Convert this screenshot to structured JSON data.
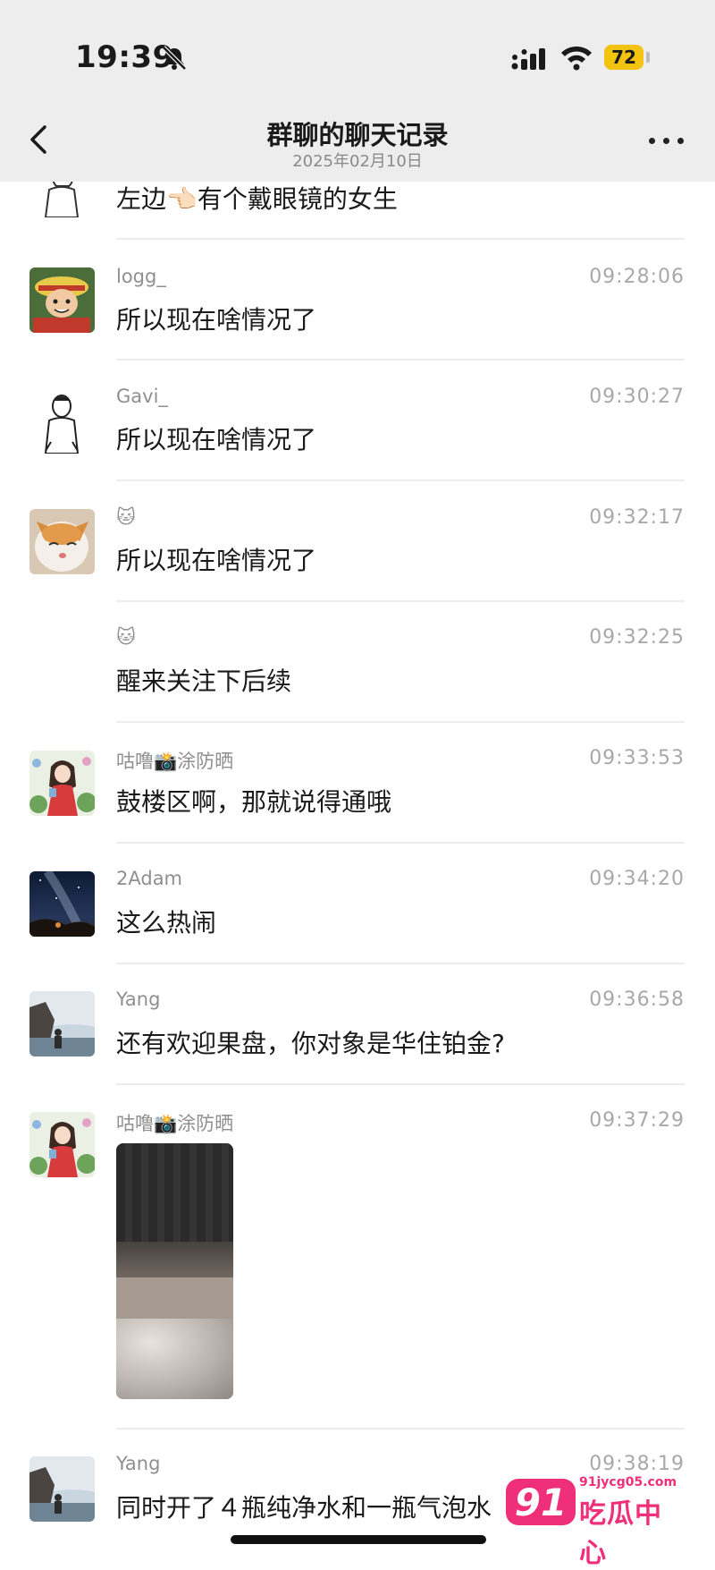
{
  "status_bar": {
    "time": "19:39",
    "battery": "72"
  },
  "header": {
    "title": "群聊的聊天记录",
    "date": "2025年02月10日"
  },
  "messages": [
    {
      "sender": "",
      "time": "",
      "text": "左边👈🏻有个戴眼镜的女生",
      "avatar": "sketch-man"
    },
    {
      "sender": "logg_",
      "time": "09:28:06",
      "text": "所以现在啥情况了",
      "avatar": "anime-pirate"
    },
    {
      "sender": "Gavi_",
      "time": "09:30:27",
      "text": "所以现在啥情况了",
      "avatar": "sketch-man"
    },
    {
      "sender": "🐱",
      "time": "09:32:17",
      "text": "所以现在啥情况了",
      "avatar": "cat"
    },
    {
      "sender": "🐱",
      "time": "09:32:25",
      "text": "醒来关注下后续",
      "avatar": ""
    },
    {
      "sender": "咕噜📸涂防晒",
      "time": "09:33:53",
      "text": "鼓楼区啊，那就说得通哦",
      "avatar": "illustrated-girl"
    },
    {
      "sender": "2Adam",
      "time": "09:34:20",
      "text": "这么热闹",
      "avatar": "night-sky"
    },
    {
      "sender": "Yang",
      "time": "09:36:58",
      "text": "还有欢迎果盘，你对象是华住铂金?",
      "avatar": "seaside-rock"
    },
    {
      "sender": "咕噜📸涂防晒",
      "time": "09:37:29",
      "text": "",
      "avatar": "illustrated-girl",
      "image": "hotel-room-photo"
    },
    {
      "sender": "Yang",
      "time": "09:38:19",
      "text": "同时开了４瓶纯净水和一瓶气泡水",
      "avatar": "seaside-rock"
    }
  ],
  "watermark": {
    "badge": "91",
    "url": "91jycg05.com",
    "name": "吃瓜中心"
  }
}
